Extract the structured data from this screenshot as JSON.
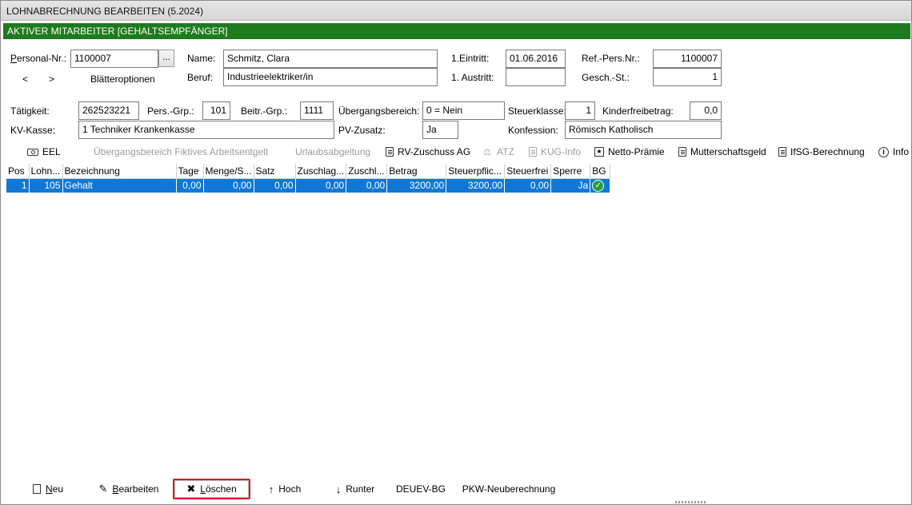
{
  "window": {
    "title": "LOHNABRECHNUNG BEARBEITEN (5.2024)",
    "status": "AKTIVER MITARBEITER [GEHALTSEMPFÄNGER]"
  },
  "employee": {
    "personal_nr_label": "Personal-Nr.:",
    "personal_nr": "1100007",
    "dots_label": "...",
    "prev_label": "<",
    "next_label": ">",
    "page_options_label": "Blätteroptionen",
    "name_label": "Name:",
    "name": "Schmitz, Clara",
    "beruf_label": "Beruf:",
    "beruf": "Industrieelektriker/in",
    "eintritt_label": "1.Eintritt:",
    "eintritt": "01.06.2016",
    "austritt_label": "1. Austritt:",
    "austritt": "",
    "ref_pers_nr_label": "Ref.-Pers.Nr.:",
    "ref_pers_nr": "1100007",
    "gesch_st_label": "Gesch.-St.:",
    "gesch_st": "1"
  },
  "details": {
    "taetigkeit_label": "Tätigkeit:",
    "taetigkeit": "262523221",
    "pers_grp_label": "Pers.-Grp.:",
    "pers_grp": "101",
    "beitr_grp_label": "Beitr.-Grp.:",
    "beitr_grp": "1111",
    "uebergang_label": "Übergangsbereich:",
    "uebergang": "0 = Nein",
    "steuerklasse_label": "Steuerklasse:",
    "steuerklasse": "1",
    "kinderfreibetrag_label": "Kinderfreibetrag:",
    "kinderfreibetrag": "0,0",
    "kv_kasse_label": "KV-Kasse:",
    "kv_kasse": "1 Techniker Krankenkasse",
    "pv_zusatz_label": "PV-Zusatz:",
    "pv_zusatz": "Ja",
    "konfession_label": "Konfession:",
    "konfession": "Römisch Katholisch"
  },
  "toolbar": {
    "eel": "EEL",
    "uebergang_fiktiv": "Übergangsbereich Fiktives Arbeitsentgelt",
    "urlaubsabgeltung": "Urlaubsabgeltung",
    "rv_zuschuss": "RV-Zuschuss AG",
    "atz": "ATZ",
    "kug_info": "KUG-Info",
    "netto_praemie": "Netto-Prämie",
    "mutterschaftsgeld": "Mutterschaftsgeld",
    "ifsg": "IfSG-Berechnung",
    "info": "Info"
  },
  "table": {
    "columns": [
      "Pos",
      "Lohn...",
      "Bezeichnung",
      "Tage",
      "Menge/S...",
      "Satz",
      "Zuschlag...",
      "Zuschl...",
      "Betrag",
      "Steuerpflic...",
      "Steuerfrei",
      "Sperre",
      "BG"
    ],
    "rows": [
      {
        "pos": "1",
        "lohnart": "105",
        "bezeichnung": "Gehalt",
        "tage": "0,00",
        "menge": "0,00",
        "satz": "0,00",
        "zuschlag1": "0,00",
        "zuschlag2": "0,00",
        "betrag": "3200,00",
        "steuerpflichtig": "3200,00",
        "steuerfrei": "0,00",
        "sperre": "Ja",
        "bg": "check-icon"
      }
    ]
  },
  "bottom": {
    "neu": "Neu",
    "bearbeiten": "Bearbeiten",
    "loeschen": "Löschen",
    "hoch": "Hoch",
    "runter": "Runter",
    "deuev": "DEUEV-BG",
    "pkw": "PKW-Neuberechnung"
  },
  "colors": {
    "status_green": "#1e7a1e",
    "selection_blue": "#0f78d7",
    "focus_red": "#d02020"
  }
}
